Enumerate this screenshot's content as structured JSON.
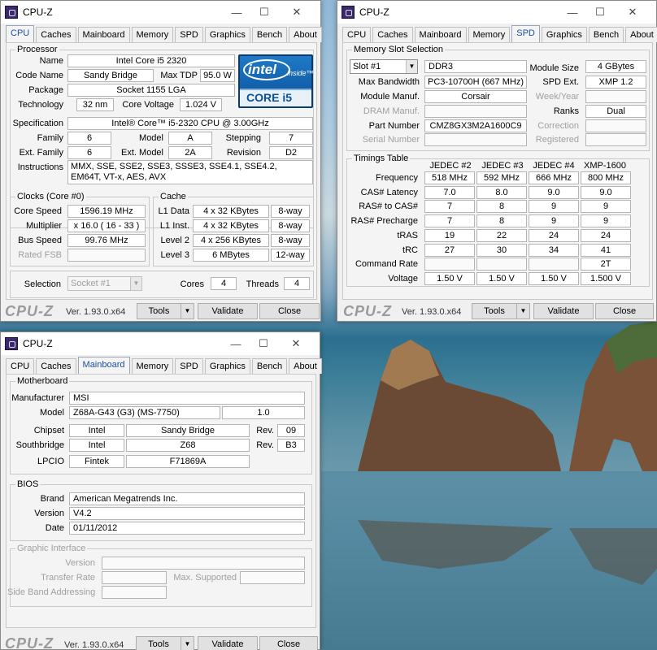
{
  "window1": {
    "title": "CPU-Z",
    "tabs": [
      "CPU",
      "Caches",
      "Mainboard",
      "Memory",
      "SPD",
      "Graphics",
      "Bench",
      "About"
    ],
    "active_tab": "CPU",
    "processor": {
      "group": "Processor",
      "labels": {
        "name": "Name",
        "codename": "Code Name",
        "maxtdp": "Max TDP",
        "package": "Package",
        "technology": "Technology",
        "corevoltage": "Core Voltage",
        "specification": "Specification",
        "family": "Family",
        "model": "Model",
        "stepping": "Stepping",
        "extfamily": "Ext. Family",
        "extmodel": "Ext. Model",
        "revision": "Revision",
        "instructions": "Instructions"
      },
      "name": "Intel Core i5 2320",
      "codename": "Sandy Bridge",
      "maxtdp": "95.0 W",
      "package": "Socket 1155 LGA",
      "technology": "32 nm",
      "corevoltage": "1.024 V",
      "specification": "Intel® Core™ i5-2320 CPU @ 3.00GHz",
      "family": "6",
      "model": "A",
      "stepping": "7",
      "extfamily": "6",
      "extmodel": "2A",
      "revision": "D2",
      "instructions": "MMX, SSE, SSE2, SSE3, SSSE3, SSE4.1, SSE4.2, EM64T, VT-x, AES, AVX"
    },
    "logo": {
      "brand": "intel",
      "tag": "inside™",
      "product": "CORE i5"
    },
    "clocks": {
      "group": "Clocks (Core #0)",
      "labels": {
        "corespeed": "Core Speed",
        "multiplier": "Multiplier",
        "busspeed": "Bus Speed",
        "ratedfsb": "Rated FSB"
      },
      "corespeed": "1596.19 MHz",
      "multiplier": "x 16.0 ( 16 - 33 )",
      "busspeed": "99.76 MHz",
      "ratedfsb": ""
    },
    "cache": {
      "group": "Cache",
      "rows": [
        {
          "label": "L1 Data",
          "size": "4 x 32 KBytes",
          "way": "8-way"
        },
        {
          "label": "L1 Inst.",
          "size": "4 x 32 KBytes",
          "way": "8-way"
        },
        {
          "label": "Level 2",
          "size": "4 x 256 KBytes",
          "way": "8-way"
        },
        {
          "label": "Level 3",
          "size": "6 MBytes",
          "way": "12-way"
        }
      ]
    },
    "selection": {
      "label": "Selection",
      "value": "Socket #1",
      "cores_label": "Cores",
      "cores": "4",
      "threads_label": "Threads",
      "threads": "4"
    },
    "footer": {
      "brand": "CPU-Z",
      "version": "Ver. 1.93.0.x64",
      "tools": "Tools",
      "validate": "Validate",
      "close": "Close"
    }
  },
  "window2": {
    "title": "CPU-Z",
    "tabs": [
      "CPU",
      "Caches",
      "Mainboard",
      "Memory",
      "SPD",
      "Graphics",
      "Bench",
      "About"
    ],
    "active_tab": "SPD",
    "slot": {
      "group": "Memory Slot Selection",
      "slot": "Slot #1",
      "type": "DDR3",
      "labels": {
        "modulesize": "Module Size",
        "maxbandwidth": "Max Bandwidth",
        "spdext": "SPD Ext.",
        "manuf": "Module Manuf.",
        "weekyear": "Week/Year",
        "dramm": "DRAM Manuf.",
        "ranks": "Ranks",
        "partnumber": "Part Number",
        "correction": "Correction",
        "serial": "Serial Number",
        "registered": "Registered"
      },
      "modulesize": "4 GBytes",
      "maxbandwidth": "PC3-10700H (667 MHz)",
      "spdext": "XMP 1.2",
      "manuf": "Corsair",
      "weekyear": "",
      "dramm": "",
      "ranks": "Dual",
      "partnumber": "CMZ8GX3M2A1600C9",
      "correction": "",
      "serial": "",
      "registered": ""
    },
    "timings": {
      "group": "Timings Table",
      "columns": [
        "JEDEC #2",
        "JEDEC #3",
        "JEDEC #4",
        "XMP-1600"
      ],
      "rows": [
        {
          "label": "Frequency",
          "values": [
            "518 MHz",
            "592 MHz",
            "666 MHz",
            "800 MHz"
          ]
        },
        {
          "label": "CAS# Latency",
          "values": [
            "7.0",
            "8.0",
            "9.0",
            "9.0"
          ]
        },
        {
          "label": "RAS# to CAS#",
          "values": [
            "7",
            "8",
            "9",
            "9"
          ]
        },
        {
          "label": "RAS# Precharge",
          "values": [
            "7",
            "8",
            "9",
            "9"
          ]
        },
        {
          "label": "tRAS",
          "values": [
            "19",
            "22",
            "24",
            "24"
          ]
        },
        {
          "label": "tRC",
          "values": [
            "27",
            "30",
            "34",
            "41"
          ]
        },
        {
          "label": "Command Rate",
          "values": [
            "",
            "",
            "",
            "2T"
          ]
        },
        {
          "label": "Voltage",
          "values": [
            "1.50 V",
            "1.50 V",
            "1.50 V",
            "1.500 V"
          ]
        }
      ]
    },
    "footer": {
      "brand": "CPU-Z",
      "version": "Ver. 1.93.0.x64",
      "tools": "Tools",
      "validate": "Validate",
      "close": "Close"
    }
  },
  "window3": {
    "title": "CPU-Z",
    "tabs": [
      "CPU",
      "Caches",
      "Mainboard",
      "Memory",
      "SPD",
      "Graphics",
      "Bench",
      "About"
    ],
    "active_tab": "Mainboard",
    "motherboard": {
      "group": "Motherboard",
      "labels": {
        "manufacturer": "Manufacturer",
        "model": "Model",
        "chipset": "Chipset",
        "southbridge": "Southbridge",
        "lpcio": "LPCIO",
        "rev": "Rev."
      },
      "manufacturer": "MSI",
      "model": "Z68A-G43 (G3) (MS-7750)",
      "model_rev": "1.0",
      "chipset_vendor": "Intel",
      "chipset": "Sandy Bridge",
      "chipset_rev": "09",
      "south_vendor": "Intel",
      "south": "Z68",
      "south_rev": "B3",
      "lpcio_vendor": "Fintek",
      "lpcio": "F71869A"
    },
    "bios": {
      "group": "BIOS",
      "labels": {
        "brand": "Brand",
        "version": "Version",
        "date": "Date"
      },
      "brand": "American Megatrends Inc.",
      "version": "V4.2",
      "date": "01/11/2012"
    },
    "graphic": {
      "group": "Graphic Interface",
      "labels": {
        "version": "Version",
        "transfer": "Transfer Rate",
        "maxsupported": "Max. Supported",
        "sideband": "Side Band Addressing"
      }
    },
    "footer": {
      "brand": "CPU-Z",
      "version": "Ver. 1.93.0.x64",
      "tools": "Tools",
      "validate": "Validate",
      "close": "Close"
    }
  }
}
